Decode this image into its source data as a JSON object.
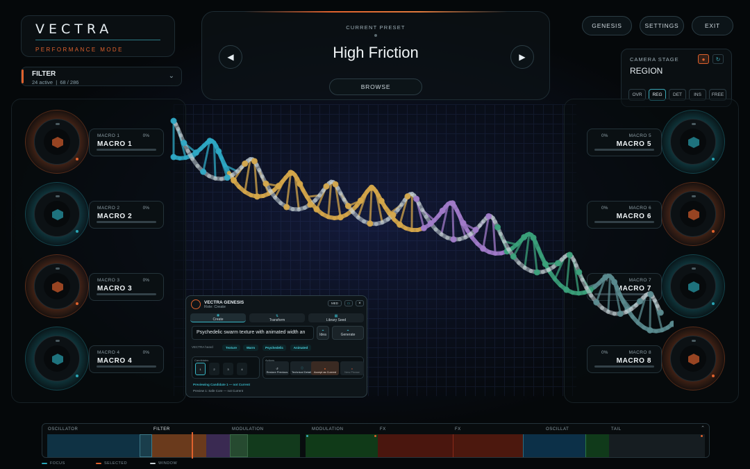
{
  "logo": {
    "name": "VECTRA",
    "mode": "PERFORMANCE MODE"
  },
  "filter": {
    "title": "FILTER",
    "active": "24 active",
    "count": "68 / 286"
  },
  "preset": {
    "label": "CURRENT PRESET",
    "name": "High Friction",
    "browse": "BROWSE"
  },
  "topnav": {
    "genesis": "GENESIS",
    "settings": "SETTINGS",
    "exit": "EXIT"
  },
  "camera": {
    "label": "CAMERA STAGE",
    "value": "REGION",
    "tabs": [
      "OVR",
      "REG",
      "DET",
      "INS",
      "FREE"
    ],
    "active_tab": "REG"
  },
  "macros_left": [
    {
      "sub": "MACRO 1",
      "pct": "0%",
      "name": "MACRO 1",
      "color": "#e0622d"
    },
    {
      "sub": "MACRO 2",
      "pct": "0%",
      "name": "MACRO 2",
      "color": "#2aa6b6"
    },
    {
      "sub": "MACRO 3",
      "pct": "0%",
      "name": "MACRO 3",
      "color": "#e0622d"
    },
    {
      "sub": "MACRO 4",
      "pct": "0%",
      "name": "MACRO 4",
      "color": "#2aa6b6"
    }
  ],
  "macros_right": [
    {
      "sub": "MACRO 5",
      "pct": "0%",
      "name": "MACRO 5",
      "color": "#2aa6b6"
    },
    {
      "sub": "MACRO 6",
      "pct": "0%",
      "name": "MACRO 6",
      "color": "#e0622d"
    },
    {
      "sub": "MACRO 7",
      "pct": "0%",
      "name": "MACRO 7",
      "color": "#2aa6b6"
    },
    {
      "sub": "MACRO 8",
      "pct": "0%",
      "name": "MACRO 8",
      "color": "#e0622d"
    }
  ],
  "genesis_panel": {
    "title": "VECTRA GENESIS",
    "role": "Role: Create",
    "badge": "MED",
    "tabs": [
      "Create",
      "Transform",
      "Library Seed"
    ],
    "prompt": "Psychedelic swarm texture with animated width an",
    "idea": "Idea",
    "generate": "Generate",
    "heard_label": "VECTRA heard",
    "chips": [
      "Texture",
      "Warm",
      "Psychedelic",
      "Animated"
    ],
    "candidates_label": "Candidates",
    "candidates": [
      "1",
      "2",
      "3",
      "4"
    ],
    "actions_label": "Actions",
    "actions": [
      "Restore Previous",
      "Technical Details",
      "Accept as Current",
      "New Phrase"
    ],
    "status": "Previewing Candidate 1 — not Current",
    "sub_status": "Preview 1: Safe Core — not Current"
  },
  "timeline": {
    "labels": [
      "OSCILLATOR",
      "FILTER",
      "MODULATION",
      "MODULATION",
      "FX",
      "FX",
      "OSCILLAT",
      "TAIL"
    ],
    "legend": [
      "FOCUS",
      "SELECTED",
      "WINDOW"
    ]
  },
  "colors": {
    "accent": "#e0622d",
    "teal": "#2aa6b6"
  }
}
